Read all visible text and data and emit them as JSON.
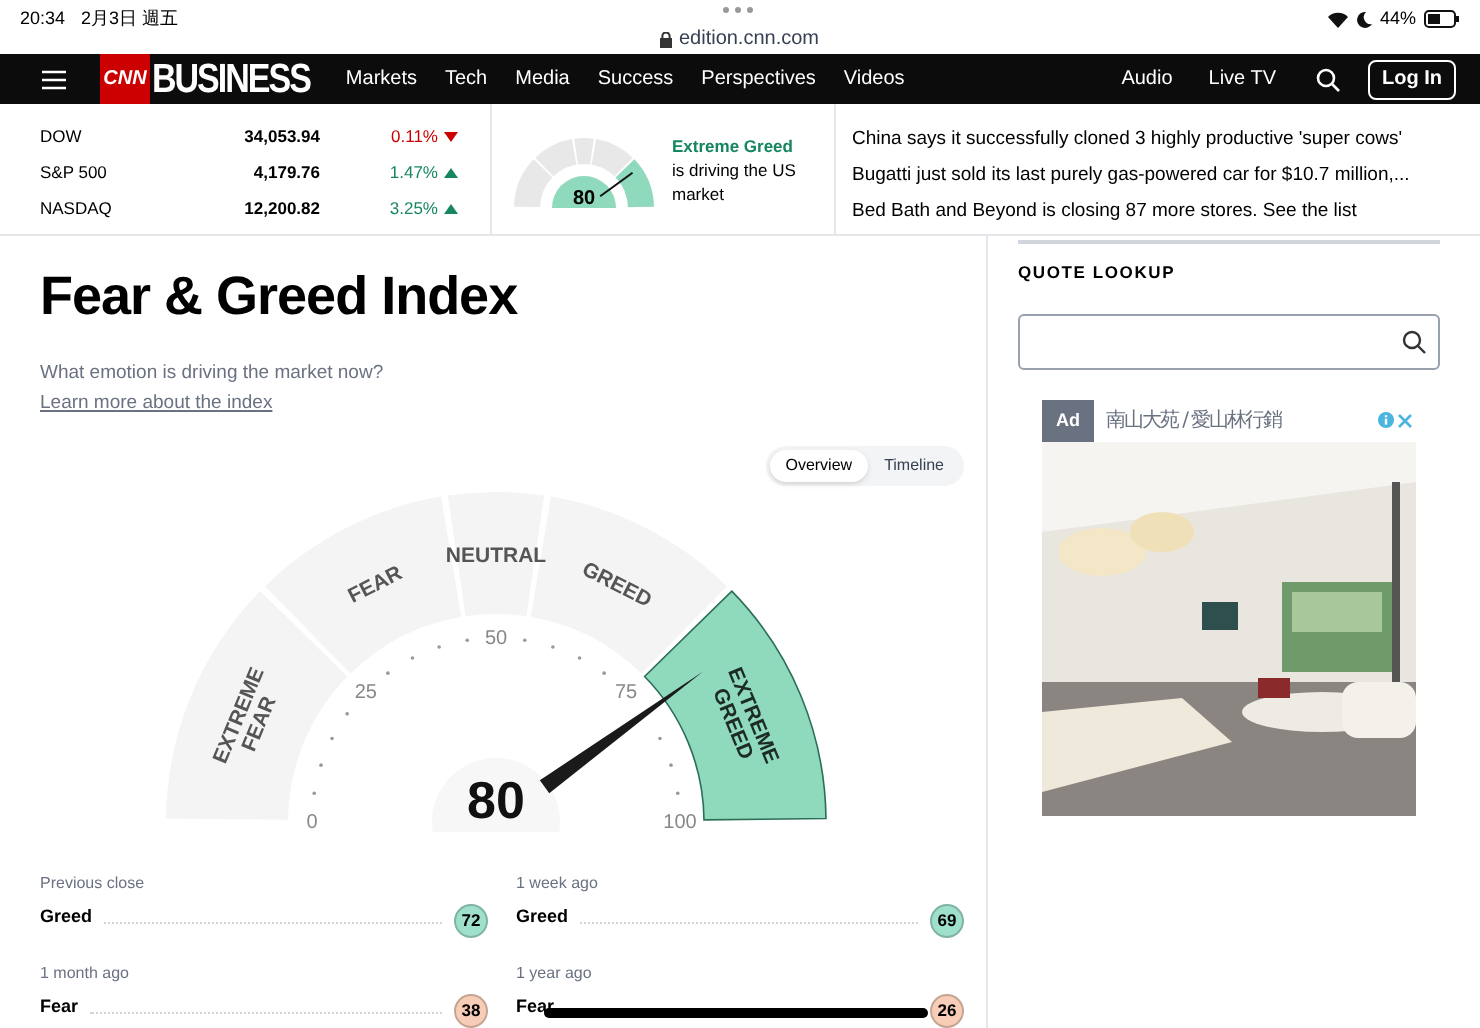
{
  "status_bar": {
    "time": "20:34",
    "date": "2月3日 週五",
    "battery": "44%",
    "url": "edition.cnn.com"
  },
  "nav": {
    "logo": "CNN",
    "section": "BUSINESS",
    "items": [
      "Markets",
      "Tech",
      "Media",
      "Success",
      "Perspectives",
      "Videos"
    ],
    "right_items": [
      "Audio",
      "Live TV"
    ],
    "login": "Log In"
  },
  "markets": [
    {
      "name": "DOW",
      "value": "34,053.94",
      "change": "0.11%",
      "down": true
    },
    {
      "name": "S&P 500",
      "value": "4,179.76",
      "change": "1.47%",
      "down": false
    },
    {
      "name": "NASDAQ",
      "value": "12,200.82",
      "change": "3.25%",
      "down": false
    }
  ],
  "fg_widget": {
    "score": "80",
    "rating": "Extreme Greed",
    "text": "is driving the US market"
  },
  "news": [
    "China says it successfully cloned 3 highly productive 'super cows'",
    "Bugatti just sold its last purely gas-powered car for $10.7 million,...",
    "Bed Bath and Beyond is closing 87 more stores. See the list"
  ],
  "title": "Fear & Greed Index",
  "subtitle": "What emotion is driving the market now?",
  "link": "Learn more about the index",
  "view_tabs": [
    {
      "label": "Overview",
      "selected": true
    },
    {
      "label": "Timeline",
      "selected": false
    }
  ],
  "gauge": {
    "segments": [
      {
        "label": "EXTREME FEAR",
        "selected": false
      },
      {
        "label": "FEAR",
        "selected": false
      },
      {
        "label": "NEUTRAL",
        "selected": false
      },
      {
        "label": "GREED",
        "selected": false
      },
      {
        "label": "EXTREME GREED",
        "selected": true
      }
    ],
    "ticks": [
      "0",
      "25",
      "50",
      "75",
      "100"
    ],
    "score": "80"
  },
  "history": [
    {
      "label": "Previous close",
      "rating": "Greed",
      "score": "72",
      "color": "#9fe0cc"
    },
    {
      "label": "1 week ago",
      "rating": "Greed",
      "score": "69",
      "color": "#9fe0cc"
    },
    {
      "label": "1 month ago",
      "rating": "Fear",
      "score": "38",
      "color": "#f8cdb7"
    },
    {
      "label": "1 year ago",
      "rating": "Fear",
      "score": "26",
      "color": "#f8cdb7"
    }
  ],
  "quote_lookup": {
    "title": "QUOTE LOOKUP"
  },
  "ad": {
    "badge": "Ad",
    "advertiser": "南山大苑 / 愛山林行銷",
    "kind": "picture"
  }
}
